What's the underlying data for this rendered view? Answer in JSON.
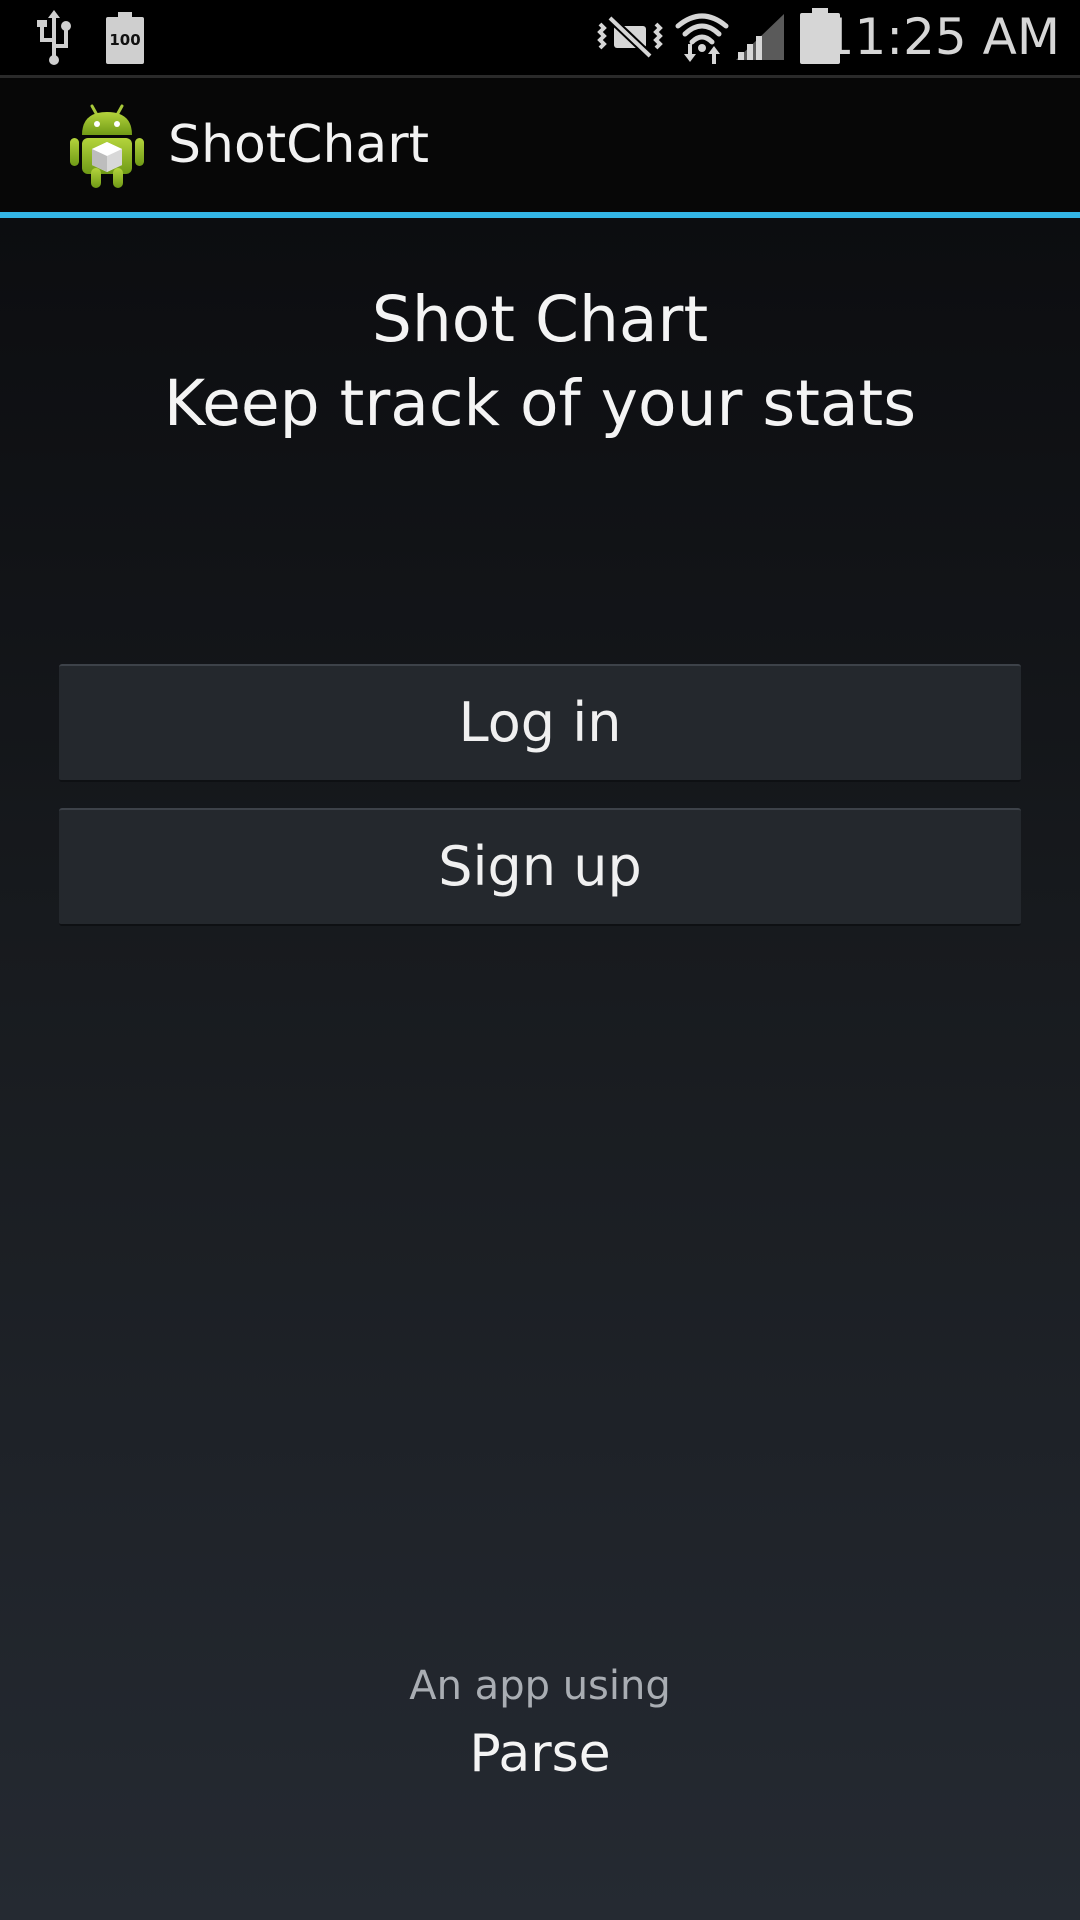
{
  "status_bar": {
    "time": "11:25 AM",
    "battery_saver_label": "100",
    "icons": [
      "usb-icon",
      "battery-saver-icon",
      "mute-icon",
      "wifi-icon",
      "signal-icon",
      "battery-icon"
    ]
  },
  "action_bar": {
    "app_title": "ShotChart",
    "app_icon": "android-app-icon",
    "accent_color": "#33b5e5"
  },
  "main": {
    "title": "Shot Chart",
    "subtitle": "Keep track of your stats",
    "buttons": {
      "login_label": "Log in",
      "signup_label": "Sign up"
    },
    "footer": {
      "caption": "An app using",
      "brand": "Parse"
    }
  }
}
